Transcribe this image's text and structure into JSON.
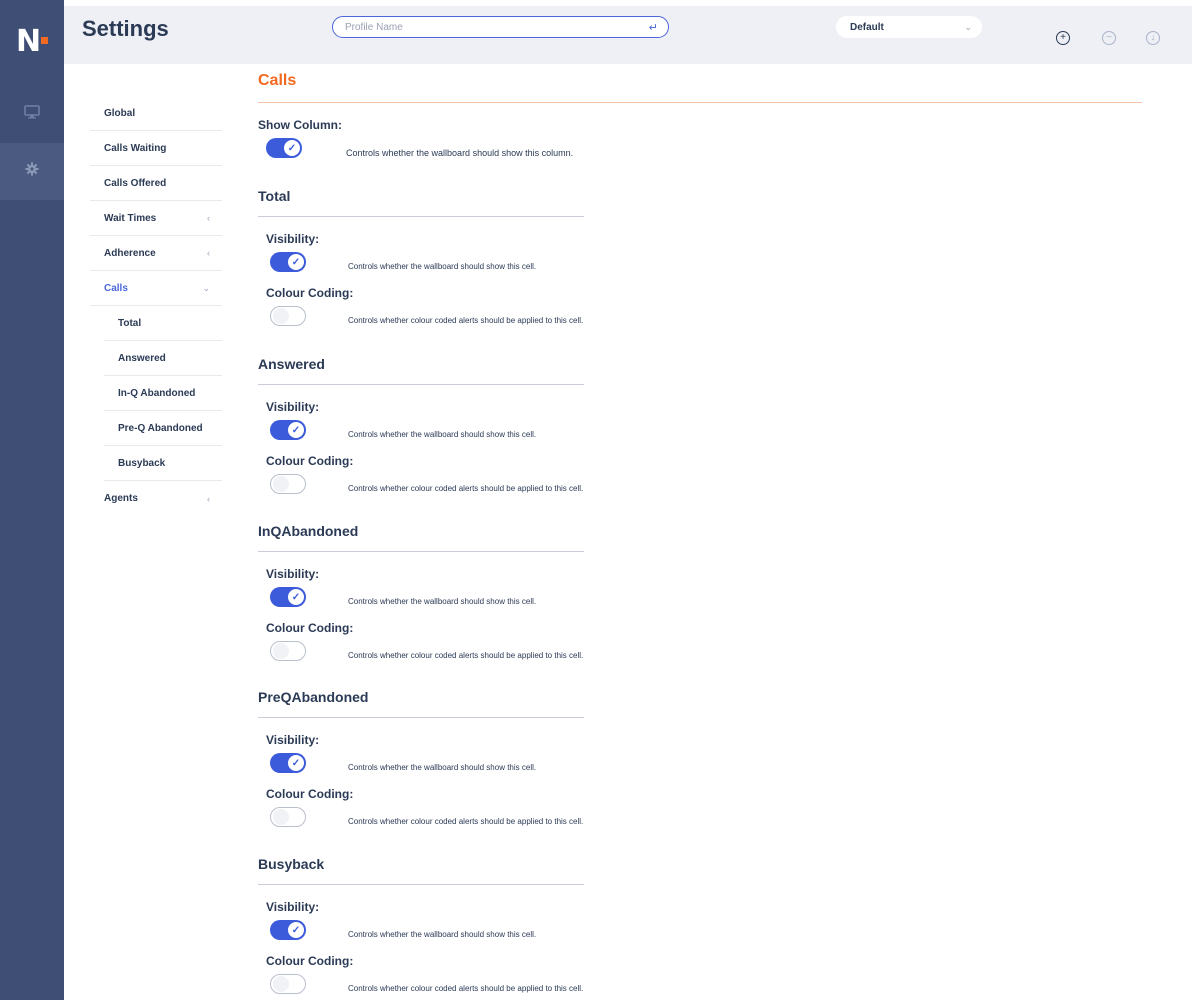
{
  "header": {
    "title": "Settings",
    "profile_placeholder": "Profile Name",
    "profile_select_value": "Default",
    "icons": [
      "add-circle-icon",
      "remove-circle-icon",
      "download-circle-icon"
    ]
  },
  "rail": {
    "logo": "N",
    "items": [
      "monitor-icon",
      "gear-icon"
    ]
  },
  "nav": {
    "items": [
      {
        "label": "Global"
      },
      {
        "label": "Calls Waiting"
      },
      {
        "label": "Calls Offered"
      },
      {
        "label": "Wait Times",
        "chevron": "‹"
      },
      {
        "label": "Adherence",
        "chevron": "‹"
      },
      {
        "label": "Calls",
        "chevron": "⌄"
      },
      {
        "label": "Total"
      },
      {
        "label": "Answered"
      },
      {
        "label": "In-Q Abandoned"
      },
      {
        "label": "Pre-Q Abandoned"
      },
      {
        "label": "Busyback"
      },
      {
        "label": "Agents",
        "chevron": "‹"
      }
    ]
  },
  "main": {
    "title": "Calls",
    "show_column": {
      "label": "Show Column:",
      "on": true,
      "desc": "Controls whether the wallboard should show this column."
    },
    "sections": [
      {
        "title": "Total",
        "vis_label": "Visibility:",
        "vis_on": true,
        "vis_desc": "Controls whether the wallboard should show this cell.",
        "cc_label": "Colour Coding:",
        "cc_on": false,
        "cc_desc": "Controls whether colour coded alerts should be applied to this cell."
      },
      {
        "title": "Answered",
        "vis_label": "Visibility:",
        "vis_on": true,
        "vis_desc": "Controls whether the wallboard should show this cell.",
        "cc_label": "Colour Coding:",
        "cc_on": false,
        "cc_desc": "Controls whether colour coded alerts should be applied to this cell."
      },
      {
        "title": "InQAbandoned",
        "vis_label": "Visibility:",
        "vis_on": true,
        "vis_desc": "Controls whether the wallboard should show this cell.",
        "cc_label": "Colour Coding:",
        "cc_on": false,
        "cc_desc": "Controls whether colour coded alerts should be applied to this cell."
      },
      {
        "title": "PreQAbandoned",
        "vis_label": "Visibility:",
        "vis_on": true,
        "vis_desc": "Controls whether the wallboard should show this cell.",
        "cc_label": "Colour Coding:",
        "cc_on": false,
        "cc_desc": "Controls whether colour coded alerts should be applied to this cell."
      },
      {
        "title": "Busyback",
        "vis_label": "Visibility:",
        "vis_on": true,
        "vis_desc": "Controls whether the wallboard should show this cell.",
        "cc_label": "Colour Coding:",
        "cc_on": false,
        "cc_desc": "Controls whether colour coded alerts should be applied to this cell."
      }
    ]
  },
  "colors": {
    "rail": "#3f4e74",
    "accent": "#3b5bdb",
    "brand_orange": "#f26a21",
    "text": "#2b3a55"
  }
}
